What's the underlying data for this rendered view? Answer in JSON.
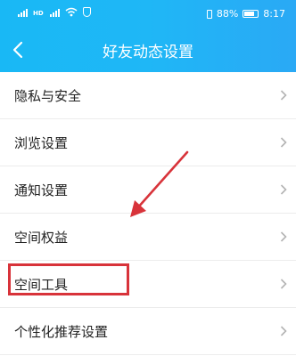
{
  "status_bar": {
    "battery_percent": "88%",
    "time": "8:17"
  },
  "header": {
    "title": "好友动态设置"
  },
  "menu": {
    "items": [
      {
        "label": "隐私与安全"
      },
      {
        "label": "浏览设置"
      },
      {
        "label": "通知设置"
      },
      {
        "label": "空间权益"
      },
      {
        "label": "空间工具"
      },
      {
        "label": "个性化推荐设置"
      }
    ]
  },
  "annotation": {
    "highlight_color": "#d8333a",
    "highlighted_item": "空间工具"
  },
  "colors": {
    "header_bg": "#1fb7f6",
    "text": "#222222",
    "divider": "#ececec"
  }
}
